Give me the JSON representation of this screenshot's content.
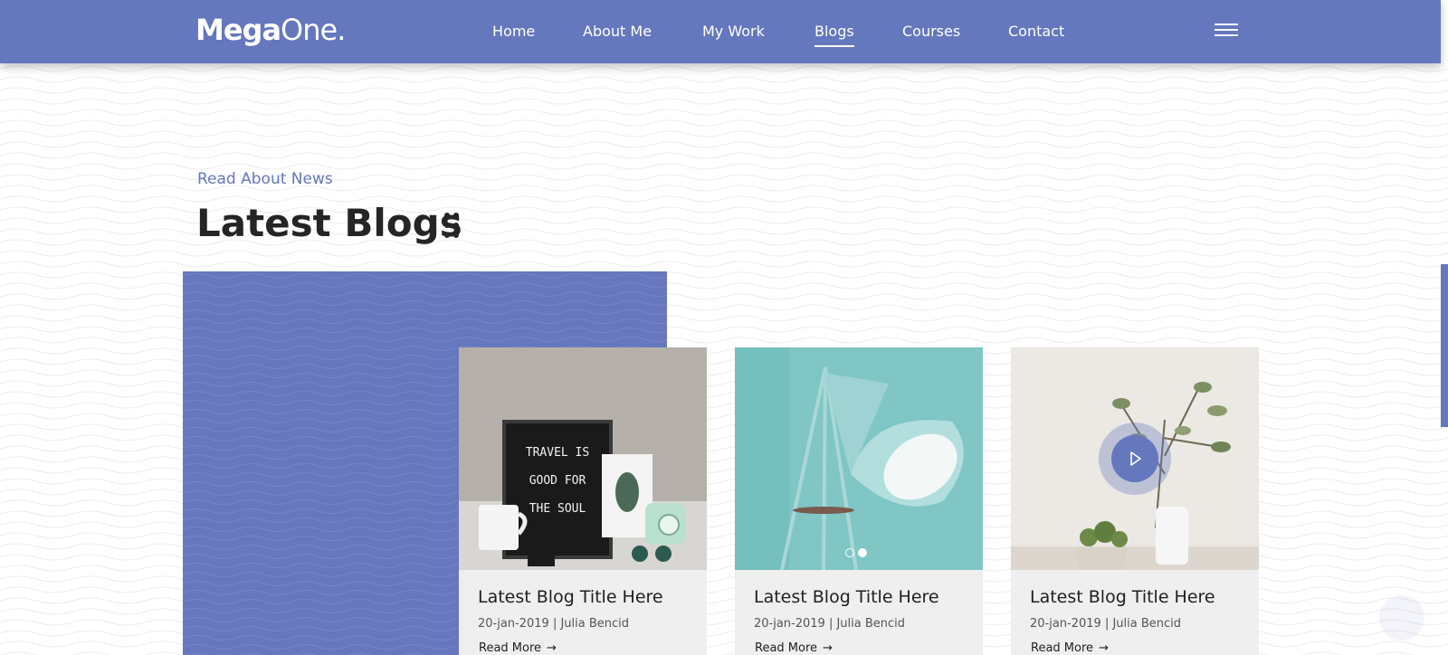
{
  "brand": {
    "logo_bold": "Mega",
    "logo_light": "One."
  },
  "nav": {
    "items": [
      {
        "label": "Home"
      },
      {
        "label": "About Me"
      },
      {
        "label": "My Work"
      },
      {
        "label": "Blogs",
        "active": true
      },
      {
        "label": "Courses"
      },
      {
        "label": "Contact"
      }
    ],
    "menu_icon": "hamburger-icon"
  },
  "section": {
    "subtitle": "Read About News",
    "heading_light": "Latest",
    "heading_bold": "Blogs",
    "heading_icon": "dots-grid-icon"
  },
  "blogs": [
    {
      "title": "Latest Blog Title Here",
      "meta": "20-jan-2019 | Julia Bencid",
      "read_more": "Read More",
      "arrow": "→",
      "image": "letter-board-travel-photo",
      "board_lines": [
        "TRAVEL IS",
        "GOOD FOR",
        "THE SOUL"
      ]
    },
    {
      "title": "Latest Blog Title Here",
      "meta": "20-jan-2019 | Julia Bencid",
      "read_more": "Read More",
      "arrow": "→",
      "image": "teal-lamp-photo",
      "slider_dots": 2
    },
    {
      "title": "Latest Blog Title Here",
      "meta": "20-jan-2019 | Julia Bencid",
      "read_more": "Read More",
      "arrow": "→",
      "image": "plant-vase-photo",
      "media_icon": "play-icon"
    }
  ],
  "colors": {
    "accent": "#6577bd",
    "card_bg": "#efefef",
    "text": "#252525"
  }
}
